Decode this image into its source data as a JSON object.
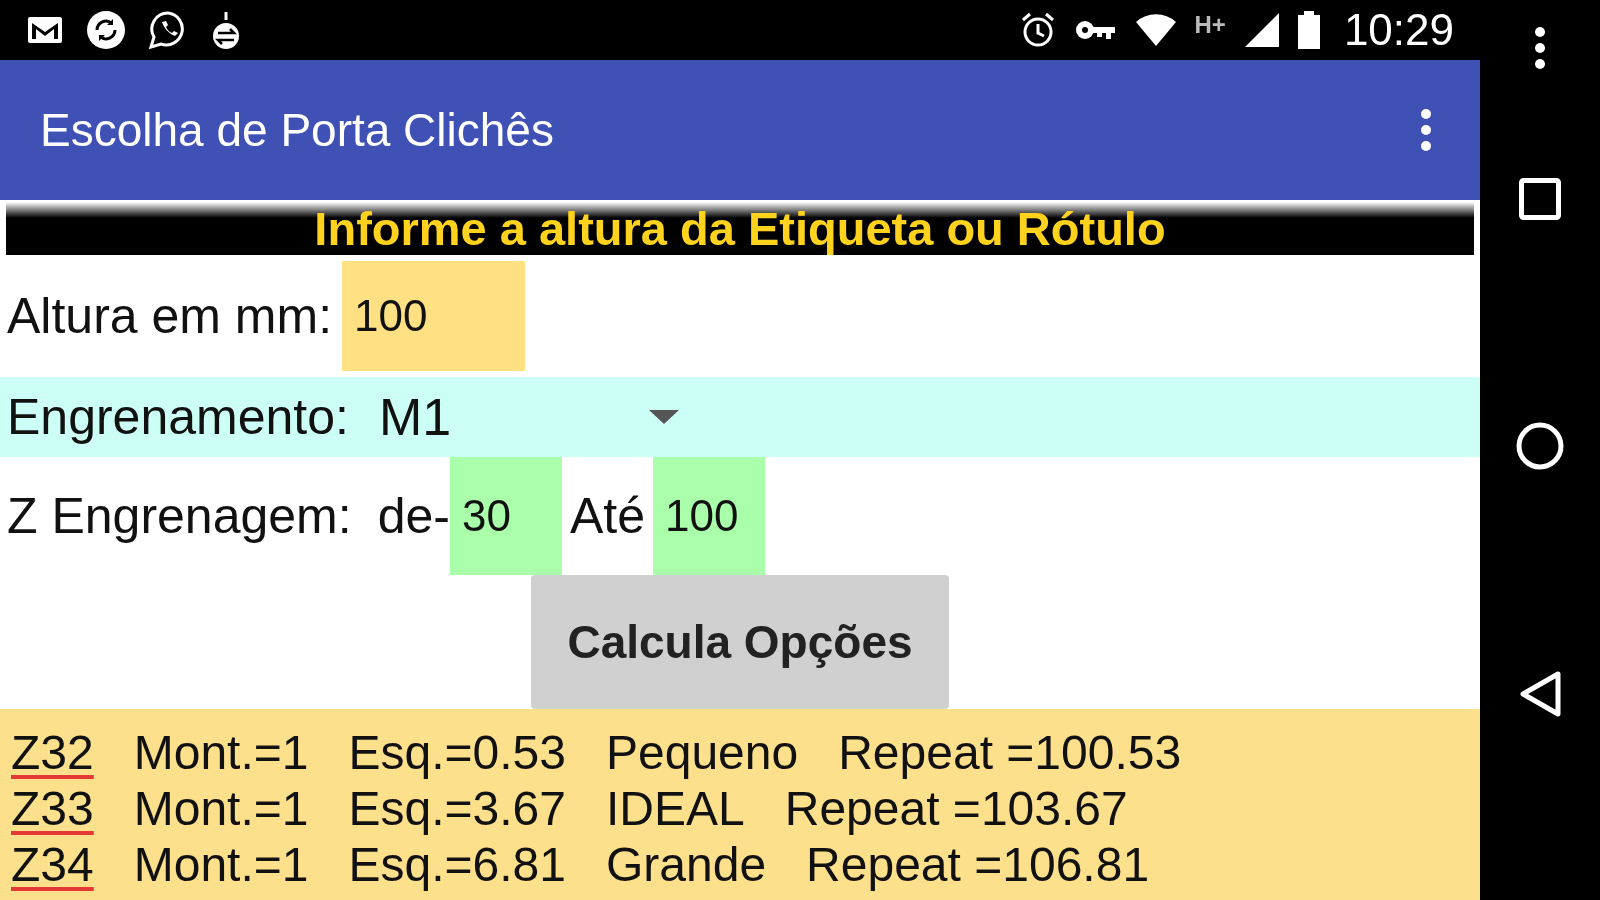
{
  "status_bar": {
    "time": "10:29",
    "network": "H+"
  },
  "app_bar": {
    "title": "Escolha de Porta Clichês"
  },
  "banner": "Informe a altura da Etiqueta ou Rótulo",
  "height_field": {
    "label": "Altura em mm:",
    "value": "100"
  },
  "gearing": {
    "label": "Engrenamento:",
    "value": "M1"
  },
  "teeth": {
    "label": "Z Engrenagem:",
    "from_label": "de-",
    "from_value": "30",
    "to_label": "Até",
    "to_value": "100"
  },
  "calculate_button": "Calcula Opções",
  "results": [
    {
      "z": "Z32",
      "mont": "Mont.=1",
      "esq": "Esq.=0.53",
      "size": "Pequeno",
      "repeat": "Repeat =100.53"
    },
    {
      "z": "Z33",
      "mont": "Mont.=1",
      "esq": "Esq.=3.67",
      "size": "IDEAL",
      "repeat": "Repeat =103.67"
    },
    {
      "z": "Z34",
      "mont": "Mont.=1",
      "esq": "Esq.=6.81",
      "size": "Grande",
      "repeat": "Repeat =106.81"
    }
  ]
}
